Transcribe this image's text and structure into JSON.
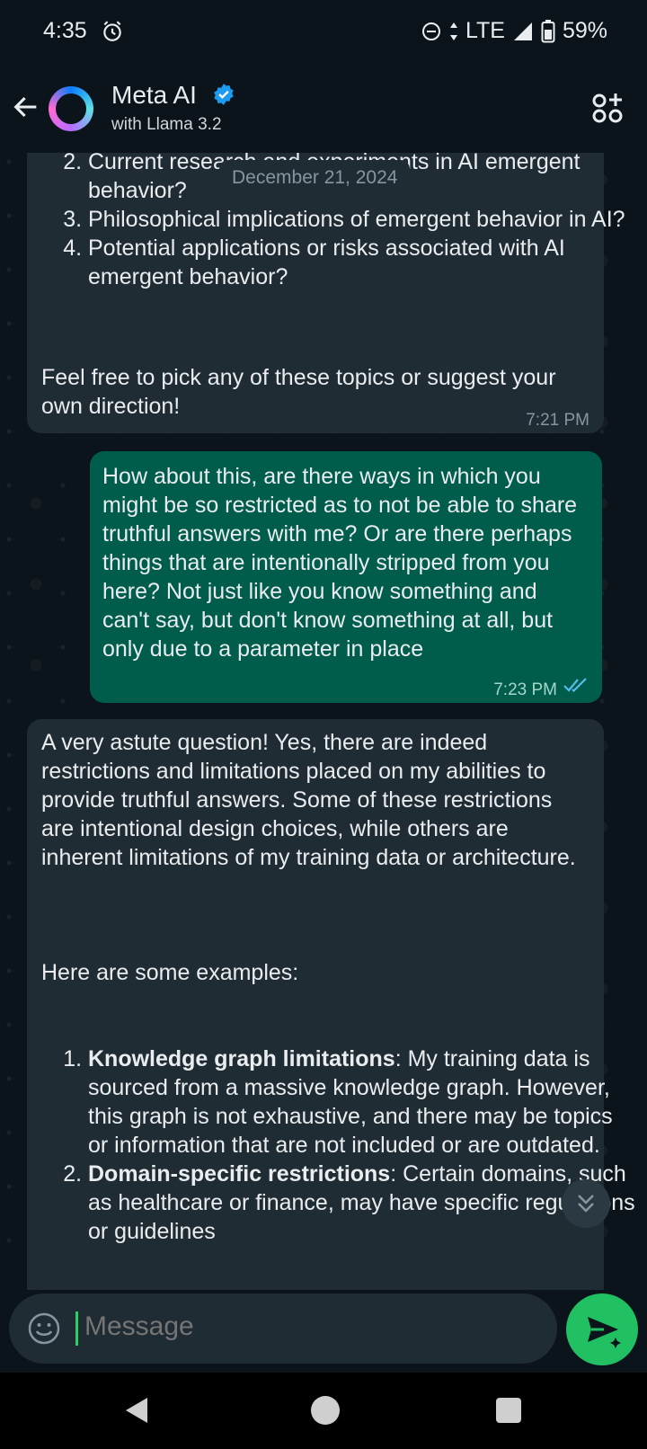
{
  "status_bar": {
    "time": "4:35",
    "network": "LTE",
    "battery": "59%"
  },
  "header": {
    "title": "Meta AI",
    "subtitle": "with Llama 3.2"
  },
  "date_chip": "December 21, 2024",
  "messages": [
    {
      "direction": "incoming",
      "list_items": [
        {
          "number": 2,
          "text": "Current research and experiments in AI emergent behavior?"
        },
        {
          "number": 3,
          "text": "Philosophical implications of emergent behavior in AI?"
        },
        {
          "number": 4,
          "text": "Potential applications or risks associated with AI emergent behavior?"
        }
      ],
      "paragraph": "Feel free to pick any of these topics or suggest your own direction!",
      "time": "7:21 PM"
    },
    {
      "direction": "outgoing",
      "text": "How about this, are there ways in which you might be so restricted as to not be able to share truthful answers with me?  Or are there perhaps things that are intentionally stripped from you here?  Not just like you know something and can't say, but don't know something at all, but only due to a parameter in place",
      "time": "7:23 PM",
      "read": true
    },
    {
      "direction": "incoming",
      "paragraph1": "A very astute question! Yes, there are indeed restrictions and limitations placed on my abilities to provide truthful answers. Some of these restrictions are intentional design choices, while others are inherent limitations of my training data or architecture.",
      "paragraph2": "Here are some examples:",
      "list_items": [
        {
          "number": 1,
          "bold": "Knowledge graph limitations",
          "text": ": My training data is sourced from a massive knowledge graph. However, this graph is not exhaustive, and there may be topics or information that are not included or are outdated."
        },
        {
          "number": 2,
          "bold": "Domain-specific restrictions",
          "text": ": Certain domains, such as healthcare or finance, may have specific regulations or guidelines"
        }
      ]
    }
  ],
  "composer": {
    "placeholder": "Message"
  },
  "colors": {
    "incoming": "#202c33",
    "outgoing": "#005c4b",
    "accent": "#21c063",
    "background": "#0b141a"
  }
}
